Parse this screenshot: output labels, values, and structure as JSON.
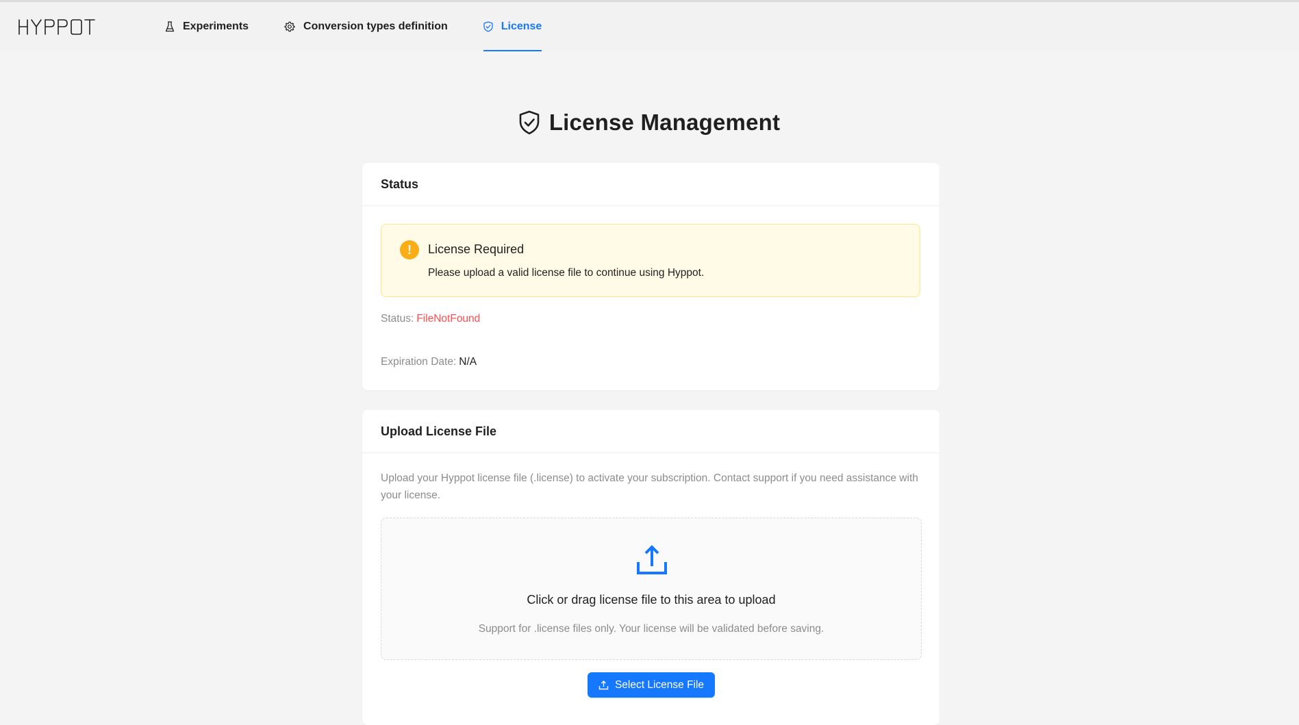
{
  "brand": {
    "logo_text": "HYPPOT"
  },
  "nav": {
    "items": [
      {
        "label": "Experiments",
        "icon": "flask-icon"
      },
      {
        "label": "Conversion types definition",
        "icon": "gear-icon"
      },
      {
        "label": "License",
        "icon": "shield-check-icon",
        "active": true
      }
    ]
  },
  "page": {
    "title": "License Management",
    "title_icon": "shield-check-icon"
  },
  "status_card": {
    "title": "Status",
    "alert": {
      "title": "License Required",
      "description": "Please upload a valid license file to continue using Hyppot.",
      "icon": "exclamation-circle-icon"
    },
    "status_label": "Status:",
    "status_value": "FileNotFound",
    "expiration_label": "Expiration Date:",
    "expiration_value": "N/A"
  },
  "upload_card": {
    "title": "Upload License File",
    "description": "Upload your Hyppot license file (.license) to activate your subscription. Contact support if you need assistance with your license.",
    "dropzone_text": "Click or drag license file to this area to upload",
    "dropzone_hint": "Support for .license files only. Your license will be validated before saving.",
    "button_label": "Select License File"
  },
  "colors": {
    "primary": "#1677ff",
    "warning": "#faad14",
    "error": "#ff4d4f",
    "background": "#f4f4f4"
  }
}
